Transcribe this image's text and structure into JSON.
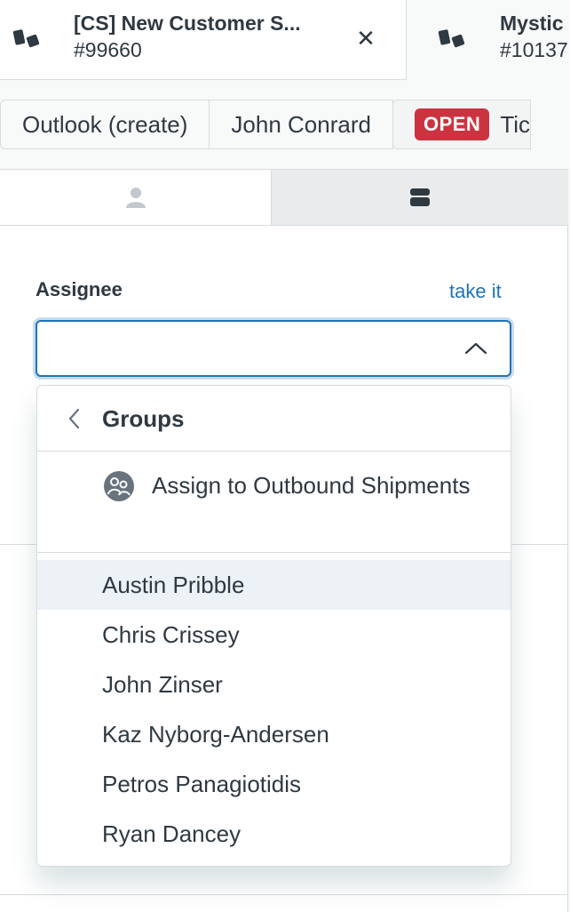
{
  "tabs": [
    {
      "title": "[CS] New Customer S...",
      "id": "#99660",
      "active": true
    },
    {
      "title": "Mystic",
      "id": "#10137",
      "active": false
    }
  ],
  "breadcrumb": {
    "items": [
      "Outlook (create)",
      "John Conrard"
    ],
    "status_badge": "OPEN",
    "ticket_label": "Tic"
  },
  "side_tabs": [
    {
      "icon": "user-icon"
    },
    {
      "icon": "app-icon"
    }
  ],
  "assignee": {
    "label": "Assignee",
    "take_it": "take it",
    "value": "",
    "placeholder": ""
  },
  "dropdown": {
    "header": "Groups",
    "group_option": "Assign to Outbound Shipments",
    "agents": [
      "Austin Pribble",
      "Chris Crissey",
      "John Zinser",
      "Kaz Nyborg-Andersen",
      "Petros Panagiotidis",
      "Ryan Dancey"
    ],
    "highlighted_index": 0
  },
  "colors": {
    "accent": "#1f73b7",
    "badge_open": "#cc3340",
    "text": "#2f3941",
    "border": "#d8dcde",
    "hover": "#edf2f7"
  }
}
